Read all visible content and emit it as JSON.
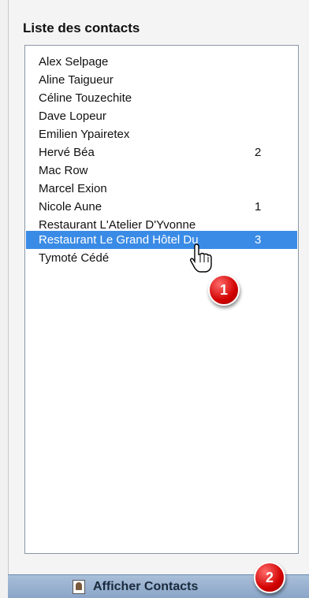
{
  "panel": {
    "title": "Liste des contacts"
  },
  "contacts": [
    {
      "name": "Alex Selpage",
      "count": ""
    },
    {
      "name": "Aline Taigueur",
      "count": ""
    },
    {
      "name": "Céline Touzechite",
      "count": ""
    },
    {
      "name": "Dave Lopeur",
      "count": ""
    },
    {
      "name": "Emilien Ypairetex",
      "count": ""
    },
    {
      "name": "Hervé Béa",
      "count": "2"
    },
    {
      "name": "Mac Row",
      "count": ""
    },
    {
      "name": "Marcel Exion",
      "count": ""
    },
    {
      "name": "Nicole Aune",
      "count": "1"
    },
    {
      "name": "Restaurant L'Atelier D'Yvonne",
      "count": ""
    },
    {
      "name": "Restaurant Le Grand Hôtel Du",
      "count": "3",
      "selected": true
    },
    {
      "name": "Tymoté Cédé",
      "count": ""
    }
  ],
  "badges": {
    "one": "1",
    "two": "2"
  },
  "bottom": {
    "button_label": "Afficher Contacts",
    "button_icon": "contact-card-icon"
  },
  "colors": {
    "selection": "#3a8be6",
    "badge": "#d10000",
    "bar": "#9db5d4"
  }
}
